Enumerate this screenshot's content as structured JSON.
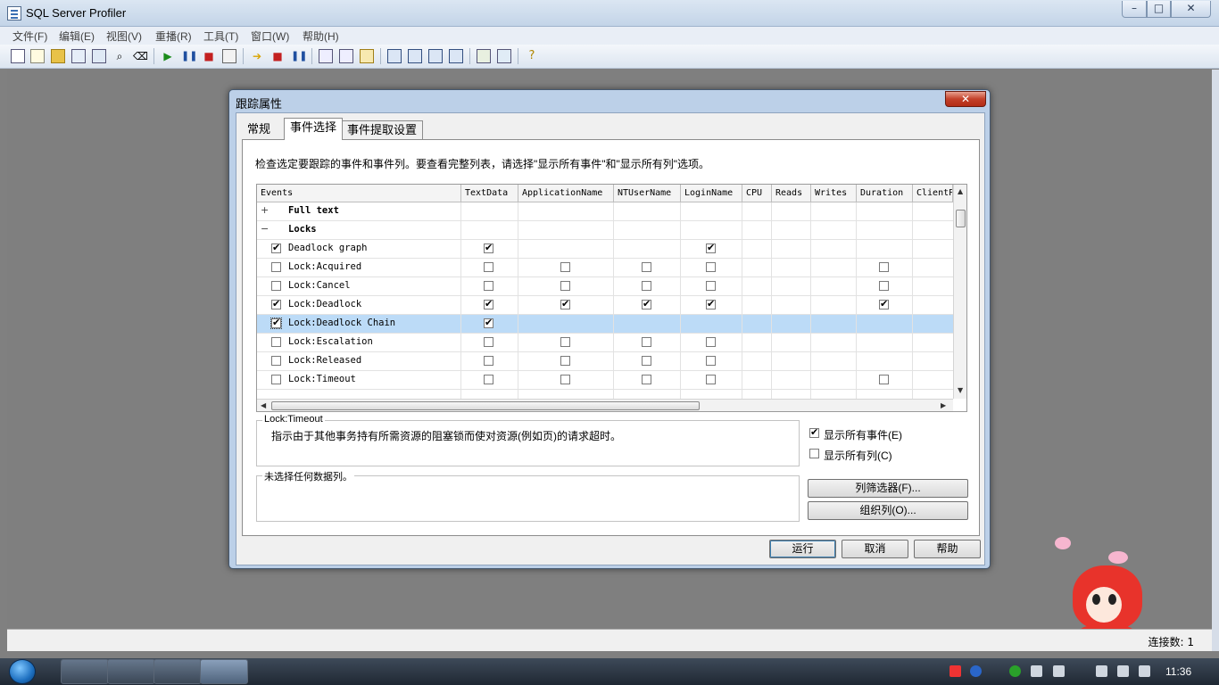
{
  "window": {
    "title": "SQL Server Profiler",
    "min": "▭",
    "max": "▢",
    "close": "✕"
  },
  "menu": [
    "文件(F)",
    "编辑(E)",
    "视图(V)",
    "重播(R)",
    "工具(T)",
    "窗口(W)",
    "帮助(H)"
  ],
  "status": {
    "connections": "连接数: 1"
  },
  "taskbar": {
    "time": "11:36"
  },
  "dialog": {
    "title": "跟踪属性",
    "close": "✕",
    "tabs": [
      "常规",
      "事件选择",
      "事件提取设置"
    ],
    "description": "检查选定要跟踪的事件和事件列。要查看完整列表，请选择\"显示所有事件\"和\"显示所有列\"选项。",
    "columns": [
      "Events",
      "TextData",
      "ApplicationName",
      "NTUserName",
      "LoginName",
      "CPU",
      "Reads",
      "Writes",
      "Duration",
      "ClientP"
    ],
    "rows": [
      {
        "type": "category",
        "expander": "+",
        "name": "Full text"
      },
      {
        "type": "category",
        "expander": "−",
        "name": "Locks"
      },
      {
        "type": "event",
        "name": "Deadlock graph",
        "checked": true,
        "cells": [
          1,
          null,
          null,
          1,
          null,
          null,
          null,
          null,
          null
        ]
      },
      {
        "type": "event",
        "name": "Lock:Acquired",
        "checked": false,
        "cells": [
          0,
          0,
          0,
          0,
          null,
          null,
          null,
          0,
          null
        ]
      },
      {
        "type": "event",
        "name": "Lock:Cancel",
        "checked": false,
        "cells": [
          0,
          0,
          0,
          0,
          null,
          null,
          null,
          0,
          null
        ]
      },
      {
        "type": "event",
        "name": "Lock:Deadlock",
        "checked": true,
        "cells": [
          1,
          1,
          1,
          1,
          null,
          null,
          null,
          1,
          null
        ]
      },
      {
        "type": "event",
        "name": "Lock:Deadlock Chain",
        "checked": true,
        "selected": true,
        "cells": [
          1,
          null,
          null,
          null,
          null,
          null,
          null,
          null,
          null
        ]
      },
      {
        "type": "event",
        "name": "Lock:Escalation",
        "checked": false,
        "cells": [
          0,
          0,
          0,
          0,
          null,
          null,
          null,
          null,
          null
        ]
      },
      {
        "type": "event",
        "name": "Lock:Released",
        "checked": false,
        "cells": [
          0,
          0,
          0,
          0,
          null,
          null,
          null,
          null,
          null
        ]
      },
      {
        "type": "event",
        "name": "Lock:Timeout",
        "checked": false,
        "cells": [
          0,
          0,
          0,
          0,
          null,
          null,
          null,
          0,
          null
        ]
      }
    ],
    "selected_event_label": "Lock:Timeout",
    "selected_event_desc": "指示由于其他事务持有所需资源的阻塞锁而使对资源(例如页)的请求超时。",
    "columns_box_label": "未选择任何数据列。",
    "show_all_events": {
      "label": "显示所有事件(E)",
      "checked": true
    },
    "show_all_columns": {
      "label": "显示所有列(C)",
      "checked": false
    },
    "btn_column_filter": "列筛选器(F)...",
    "btn_organize": "组织列(O)...",
    "btn_run": "运行",
    "btn_cancel": "取消",
    "btn_help": "帮助"
  }
}
